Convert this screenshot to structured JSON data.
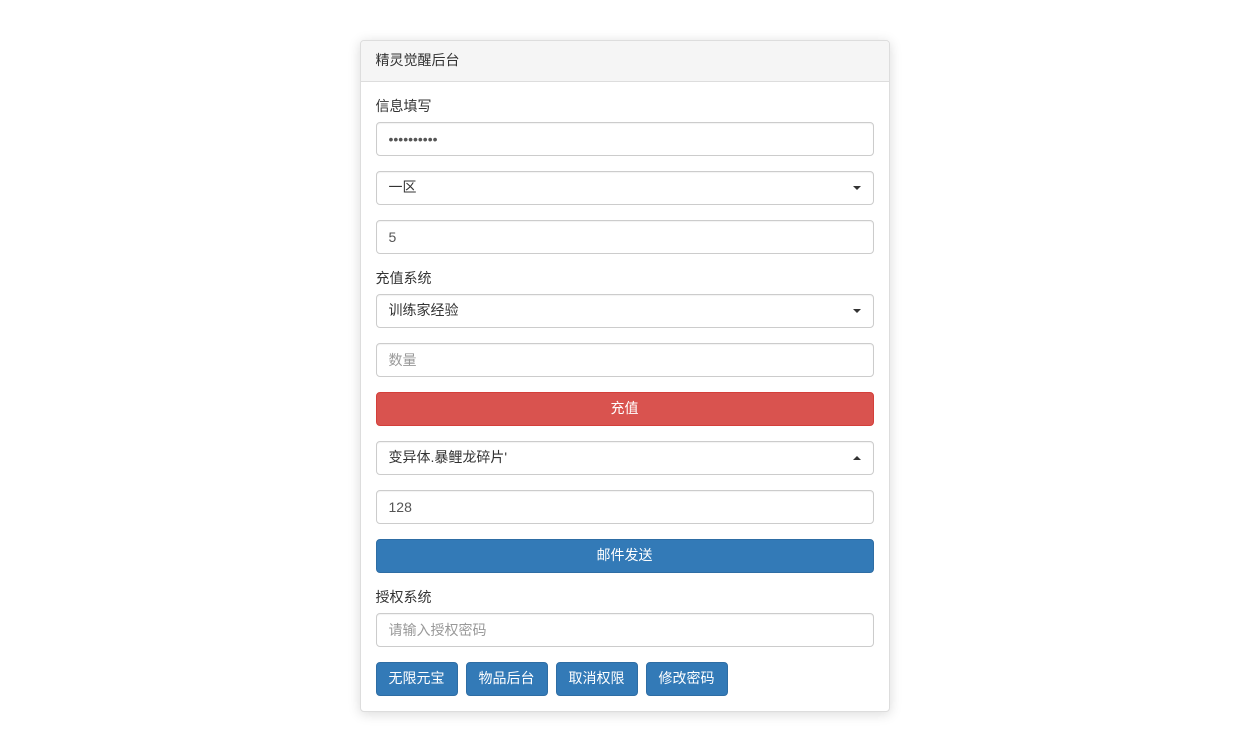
{
  "panel": {
    "title": "精灵觉醒后台"
  },
  "info": {
    "label": "信息填写",
    "password_value": "••••••••••",
    "zone_selected": "一区",
    "number_value": "5"
  },
  "recharge": {
    "label": "充值系统",
    "type_selected": "训练家经验",
    "quantity_placeholder": "数量",
    "button": "充值"
  },
  "mail": {
    "item_selected": "变异体.暴鲤龙碎片'",
    "count_value": "128",
    "button": "邮件发送"
  },
  "auth": {
    "label": "授权系统",
    "placeholder": "请输入授权密码"
  },
  "buttons": {
    "unlimited": "无限元宝",
    "items": "物品后台",
    "revoke": "取消权限",
    "change_pwd": "修改密码"
  }
}
